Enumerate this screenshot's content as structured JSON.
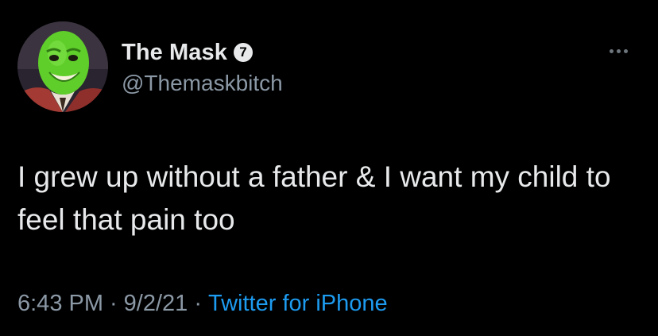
{
  "tweet": {
    "author": {
      "display_name": "The Mask",
      "handle": "@Themaskbitch",
      "verified_icon": "7",
      "avatar_icon": "green-mask-face-avatar"
    },
    "menu_icon": "more-horizontal-icon",
    "text": "I grew up without a father & I want my child to feel that pain too",
    "time": "6:43 PM",
    "separator": "·",
    "date": "9/2/21",
    "source": "Twitter for iPhone"
  },
  "colors": {
    "background": "#000000",
    "primary_text": "#e7e9ea",
    "secondary_text": "#8b98a5",
    "link": "#1d9bf0",
    "avatar_face": "#5fce2a"
  }
}
